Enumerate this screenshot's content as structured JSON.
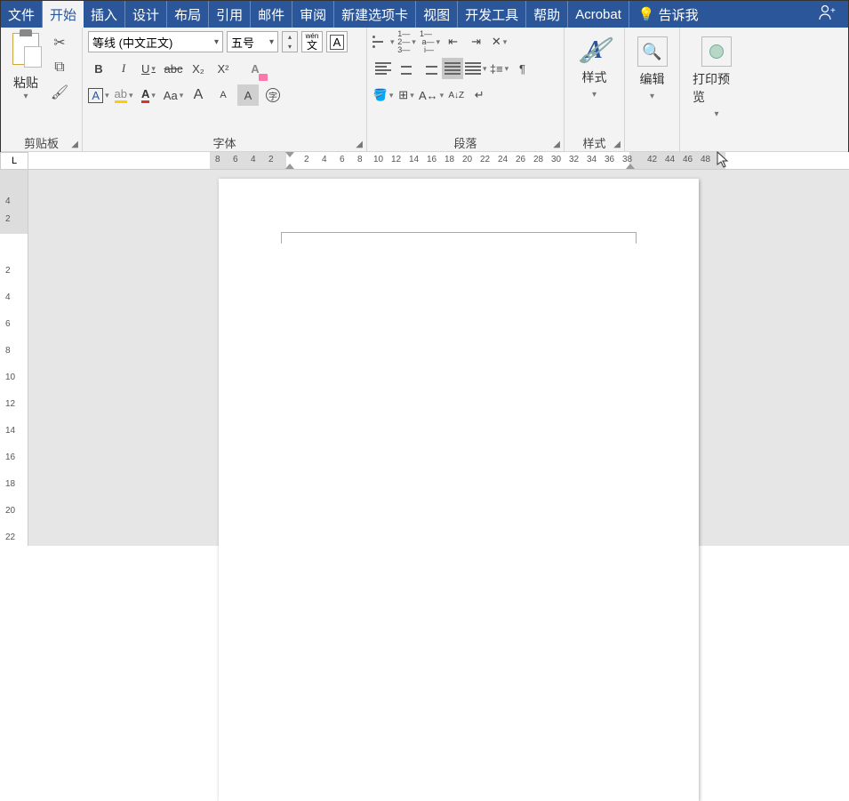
{
  "tabs": {
    "file": "文件",
    "home": "开始",
    "insert": "插入",
    "design": "设计",
    "layout": "布局",
    "references": "引用",
    "mailings": "邮件",
    "review": "审阅",
    "newtab": "新建选项卡",
    "view": "视图",
    "developer": "开发工具",
    "help": "帮助",
    "acrobat": "Acrobat",
    "tellme": "告诉我"
  },
  "clipboard": {
    "paste": "粘贴",
    "group": "剪贴板"
  },
  "font": {
    "name": "等线 (中文正文)",
    "size": "五号",
    "wen": "wén",
    "wenchar": "文",
    "group": "字体",
    "bold": "B",
    "italic": "I",
    "underline": "U",
    "strike": "abc",
    "sub": "X₂",
    "sup": "X²",
    "A1": "A",
    "A2": "A",
    "Aa": "Aa",
    "bigA": "A",
    "smallA": "A",
    "circledA": "A",
    "enclosed": "字"
  },
  "paragraph": {
    "group": "段落",
    "sortAZ": "A↓Z"
  },
  "styles": {
    "label": "样式",
    "group": "样式"
  },
  "editing": {
    "label": "编辑"
  },
  "preview": {
    "label": "打印预览"
  },
  "ruler": {
    "corner": "L",
    "h": [
      "8",
      "6",
      "4",
      "2",
      "",
      "2",
      "4",
      "6",
      "8",
      "10",
      "12",
      "14",
      "16",
      "18",
      "20",
      "22",
      "24",
      "26",
      "28",
      "30",
      "32",
      "34",
      "36",
      "38",
      "",
      "42",
      "44",
      "46",
      "48"
    ],
    "v_top": [
      "4",
      "2"
    ],
    "v": [
      "2",
      "4",
      "6",
      "8",
      "10",
      "12",
      "14",
      "16",
      "18",
      "20",
      "22"
    ]
  }
}
